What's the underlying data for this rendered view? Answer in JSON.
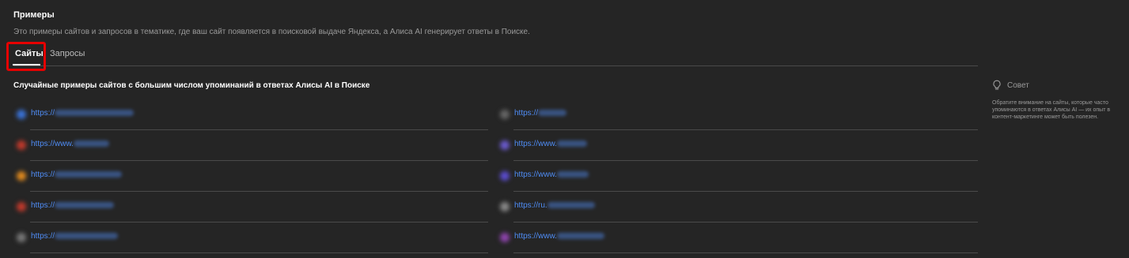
{
  "header": {
    "title": "Примеры",
    "description": "Это примеры сайтов и запросов в тематике, где ваш сайт появляется в поисковой выдаче Яндекса, а Алиса AI генерирует ответы в Поиске."
  },
  "tabs": {
    "sites": "Сайты",
    "queries": "Запросы",
    "active": "sites"
  },
  "list": {
    "title": "Случайные примеры сайтов с большим числом упоминаний в ответах Алисы AI в Поиске",
    "left": [
      {
        "url": "https://",
        "favicon_color": "#3a73d8"
      },
      {
        "url": "https://www.",
        "favicon_color": "#c0392b"
      },
      {
        "url": "https://",
        "favicon_color": "#e08a1e"
      },
      {
        "url": "https://",
        "favicon_color": "#c0392b"
      },
      {
        "url": "https://",
        "favicon_color": "#777777"
      }
    ],
    "right": [
      {
        "url": "https://",
        "favicon_color": "#666666"
      },
      {
        "url": "https://www.",
        "favicon_color": "#6a5acd"
      },
      {
        "url": "https://www.",
        "favicon_color": "#5b4ccf"
      },
      {
        "url": "https://ru.",
        "favicon_color": "#888888"
      },
      {
        "url": "https://www.",
        "favicon_color": "#8e44ad"
      }
    ]
  },
  "tip": {
    "title": "Совет",
    "text": "Обратите внимание на сайты, которые часто упоминаются в ответах Алисы AI — их опыт в контент-маркетинге может быть полезен."
  },
  "colors": {
    "background": "#252525",
    "link": "#4f8df6",
    "highlight": "#e60000",
    "muted": "#9a9a9a",
    "divider": "#4a4a4a"
  }
}
